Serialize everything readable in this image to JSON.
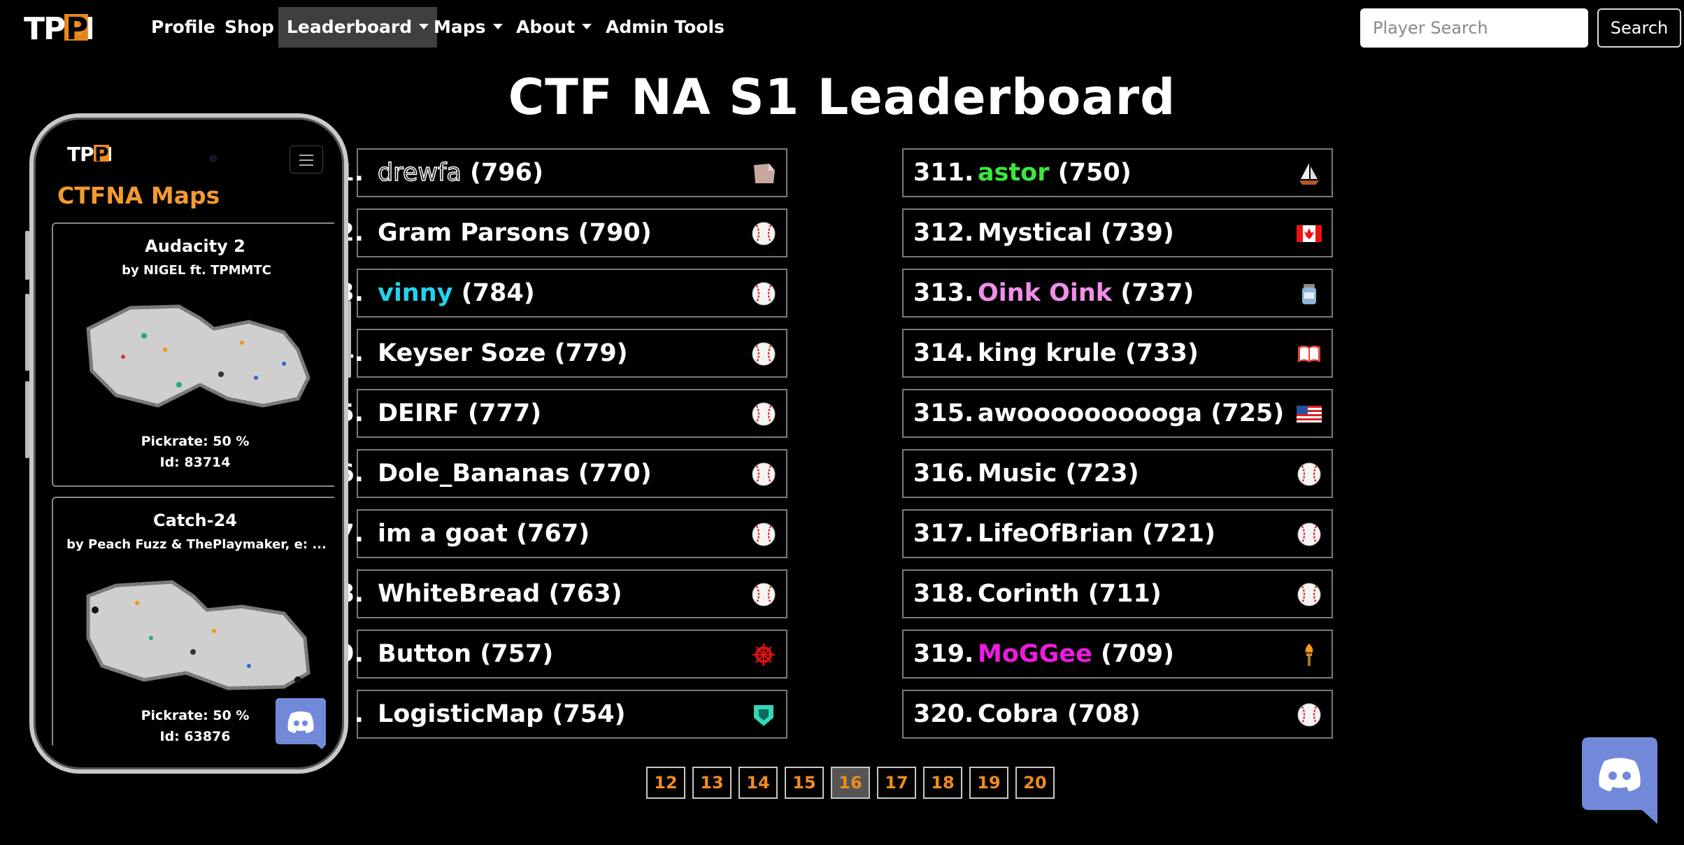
{
  "nav": {
    "logo_text": "TPM",
    "items": [
      {
        "label": "Profile"
      },
      {
        "label": "Shop"
      },
      {
        "label": "Leaderboard"
      },
      {
        "label": "Maps"
      },
      {
        "label": "About"
      },
      {
        "label": "Admin Tools"
      }
    ],
    "search_placeholder": "Player Search",
    "search_button": "Search"
  },
  "title": "CTF NA S1 Leaderboard",
  "leaderboard": {
    "left": [
      {
        "rank": "1.",
        "name": "drewfa",
        "score": "(796)",
        "name_color": "outline",
        "icon": "skin-flair-icon"
      },
      {
        "rank": "2.",
        "name": "Gram Parsons",
        "score": "(790)",
        "name_color": "#ffffff",
        "icon": "baseball-icon"
      },
      {
        "rank": "3.",
        "name": "vinny",
        "score": "(784)",
        "name_color": "#22d3ee",
        "icon": "baseball-icon"
      },
      {
        "rank": "4.",
        "name": "Keyser Soze",
        "score": "(779)",
        "name_color": "#ffffff",
        "icon": "baseball-icon"
      },
      {
        "rank": "5.",
        "name": "DEIRF",
        "score": "(777)",
        "name_color": "#ffffff",
        "icon": "baseball-icon"
      },
      {
        "rank": "6.",
        "name": "Dole_Bananas",
        "score": "(770)",
        "name_color": "#ffffff",
        "icon": "baseball-icon"
      },
      {
        "rank": "7.",
        "name": "im a goat",
        "score": "(767)",
        "name_color": "#ffffff",
        "icon": "baseball-icon"
      },
      {
        "rank": "8.",
        "name": "WhiteBread",
        "score": "(763)",
        "name_color": "#ffffff",
        "icon": "baseball-icon"
      },
      {
        "rank": "9.",
        "name": "Button",
        "score": "(757)",
        "name_color": "#ffffff",
        "icon": "ship-wheel-icon"
      },
      {
        "rank": ".",
        "name": "LogisticMap",
        "score": "(754)",
        "name_color": "#ffffff",
        "icon": "shield-flair-icon"
      }
    ],
    "right": [
      {
        "rank": "311.",
        "name": "astor",
        "score": "(750)",
        "name_color": "#39e83a",
        "icon": "sailboat-icon"
      },
      {
        "rank": "312.",
        "name": "Mystical",
        "score": "(739)",
        "name_color": "#ffffff",
        "icon": "canada-flag-icon"
      },
      {
        "rank": "313.",
        "name": "Oink Oink",
        "score": "(737)",
        "name_color": "#f08ee8",
        "icon": "jar-icon"
      },
      {
        "rank": "314.",
        "name": "king krule",
        "score": "(733)",
        "name_color": "#ffffff",
        "icon": "book-icon"
      },
      {
        "rank": "315.",
        "name": "awoooooooooga",
        "score": "(725)",
        "name_color": "#ffffff",
        "icon": "usa-flag-icon"
      },
      {
        "rank": "316.",
        "name": "Music",
        "score": "(723)",
        "name_color": "#ffffff",
        "icon": "baseball-icon"
      },
      {
        "rank": "317.",
        "name": "LifeOfBrian",
        "score": "(721)",
        "name_color": "#ffffff",
        "icon": "baseball-icon"
      },
      {
        "rank": "318.",
        "name": "Corinth",
        "score": "(711)",
        "name_color": "#ffffff",
        "icon": "baseball-icon"
      },
      {
        "rank": "319.",
        "name": "MoGGee",
        "score": "(709)",
        "name_color": "#ee1be0",
        "icon": "torch-icon"
      },
      {
        "rank": "320.",
        "name": "Cobra",
        "score": "(708)",
        "name_color": "#ffffff",
        "icon": "baseball-icon"
      }
    ]
  },
  "pagination": {
    "pages": [
      "12",
      "13",
      "14",
      "15",
      "16",
      "17",
      "18",
      "19",
      "20"
    ],
    "current": "16"
  },
  "phone": {
    "logo_text": "TPM",
    "title": "CTFNA Maps",
    "maps": [
      {
        "name": "Audacity 2",
        "author": "by NIGEL ft. TPMMTC",
        "pickrate": "Pickrate: 50 %",
        "id": "Id: 83714"
      },
      {
        "name": "Catch-24",
        "author": "by Peach Fuzz & ThePlaymaker, e: ...",
        "pickrate": "Pickrate: 50 %",
        "id": "Id: 63876"
      }
    ]
  },
  "colors": {
    "accent_orange": "#f08c1c",
    "nav_active_bg": "#3f3f3f",
    "discord_blue": "#7289da"
  }
}
